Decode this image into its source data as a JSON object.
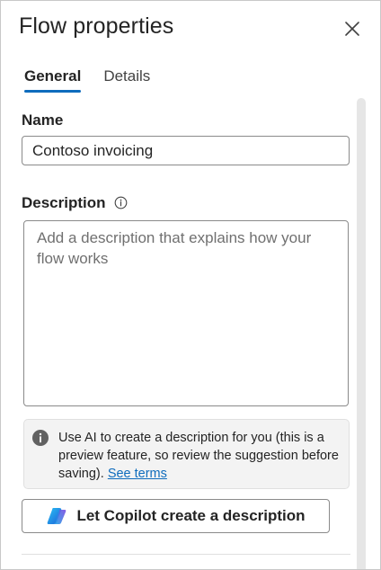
{
  "panel": {
    "title": "Flow properties",
    "close_icon": "close-icon"
  },
  "tabs": [
    {
      "label": "General",
      "active": true
    },
    {
      "label": "Details",
      "active": false
    }
  ],
  "form": {
    "name_label": "Name",
    "name_value": "Contoso invoicing",
    "description_label": "Description",
    "description_info_icon": "info-icon",
    "description_placeholder": "Add a description that explains how your flow works",
    "description_value": ""
  },
  "ai_notice": {
    "icon": "info-filled-icon",
    "text": "Use AI to create a description for you (this is a preview feature, so review the suggestion before saving).",
    "link_text": "See terms"
  },
  "copilot_button": {
    "icon": "copilot-icon",
    "label": "Let Copilot create a description"
  },
  "colors": {
    "accent": "#0f6cbd",
    "text": "#242424",
    "border": "#8a8a8a",
    "notice_bg": "#f3f3f3"
  }
}
